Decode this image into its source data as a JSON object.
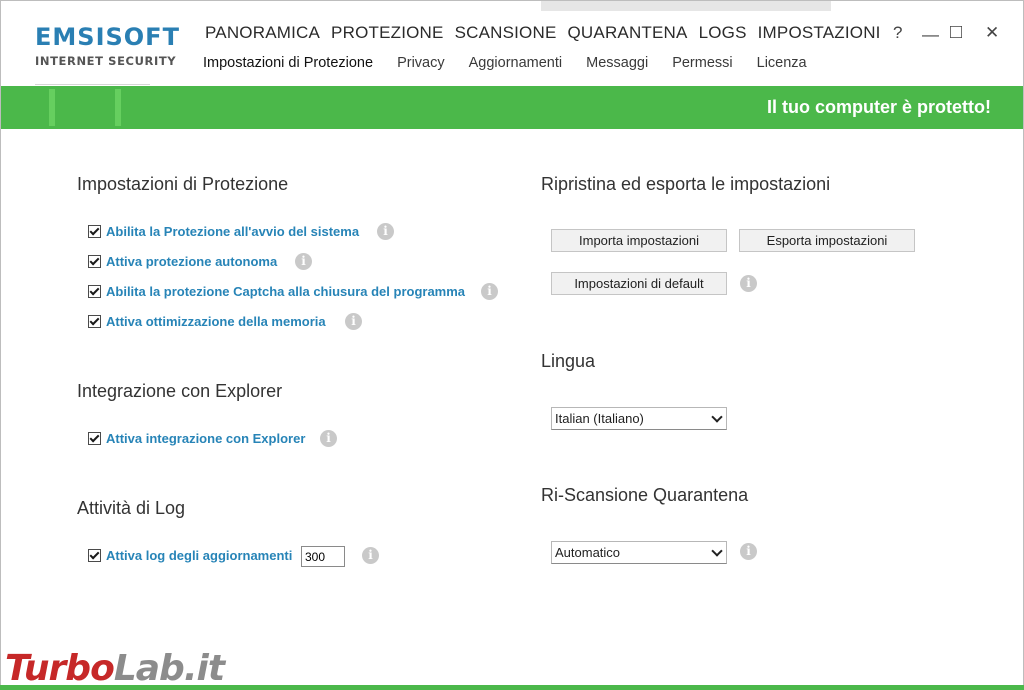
{
  "app": {
    "logo_main": "EMSISOFT",
    "logo_sub": "INTERNET SECURITY"
  },
  "main_nav": [
    {
      "label": "PANORAMICA"
    },
    {
      "label": "PROTEZIONE"
    },
    {
      "label": "SCANSIONE"
    },
    {
      "label": "QUARANTENA"
    },
    {
      "label": "LOGS"
    },
    {
      "label": "IMPOSTAZIONI"
    }
  ],
  "sub_nav": [
    {
      "label": "Impostazioni di Protezione"
    },
    {
      "label": "Privacy"
    },
    {
      "label": "Aggiornamenti"
    },
    {
      "label": "Messaggi"
    },
    {
      "label": "Permessi"
    },
    {
      "label": "Licenza"
    }
  ],
  "window_controls": {
    "help": "?",
    "minimize": "—",
    "maximize": "□",
    "close": "✕"
  },
  "status": {
    "text": "Il tuo computer è protetto!",
    "color": "#4bb84a"
  },
  "protection": {
    "title": "Impostazioni di Protezione",
    "options": [
      {
        "label": "Abilita la Protezione all'avvio del sistema",
        "checked": true
      },
      {
        "label": "Attiva protezione autonoma",
        "checked": true
      },
      {
        "label": "Abilita la protezione Captcha alla chiusura del programma",
        "checked": true
      },
      {
        "label": "Attiva ottimizzazione della memoria",
        "checked": true
      }
    ]
  },
  "explorer": {
    "title": "Integrazione con Explorer",
    "option": {
      "label": "Attiva integrazione con Explorer",
      "checked": true
    }
  },
  "log": {
    "title": "Attività di Log",
    "option": {
      "label": "Attiva log degli aggiornamenti",
      "checked": true
    },
    "value": "300"
  },
  "restore": {
    "title": "Ripristina ed esporta le impostazioni",
    "import_label": "Importa impostazioni",
    "export_label": "Esporta impostazioni",
    "default_label": "Impostazioni di default"
  },
  "language": {
    "title": "Lingua",
    "selected": "Italian (Italiano)"
  },
  "rescan": {
    "title": "Ri-Scansione Quarantena",
    "selected": "Automatico"
  },
  "icons": {
    "info": "i"
  },
  "watermark": {
    "part1": "Turbo",
    "part2": "Lab.it"
  },
  "colors": {
    "accent": "#2784b7",
    "status_green": "#4bb84a",
    "logo_blue": "#2a7fb3"
  }
}
